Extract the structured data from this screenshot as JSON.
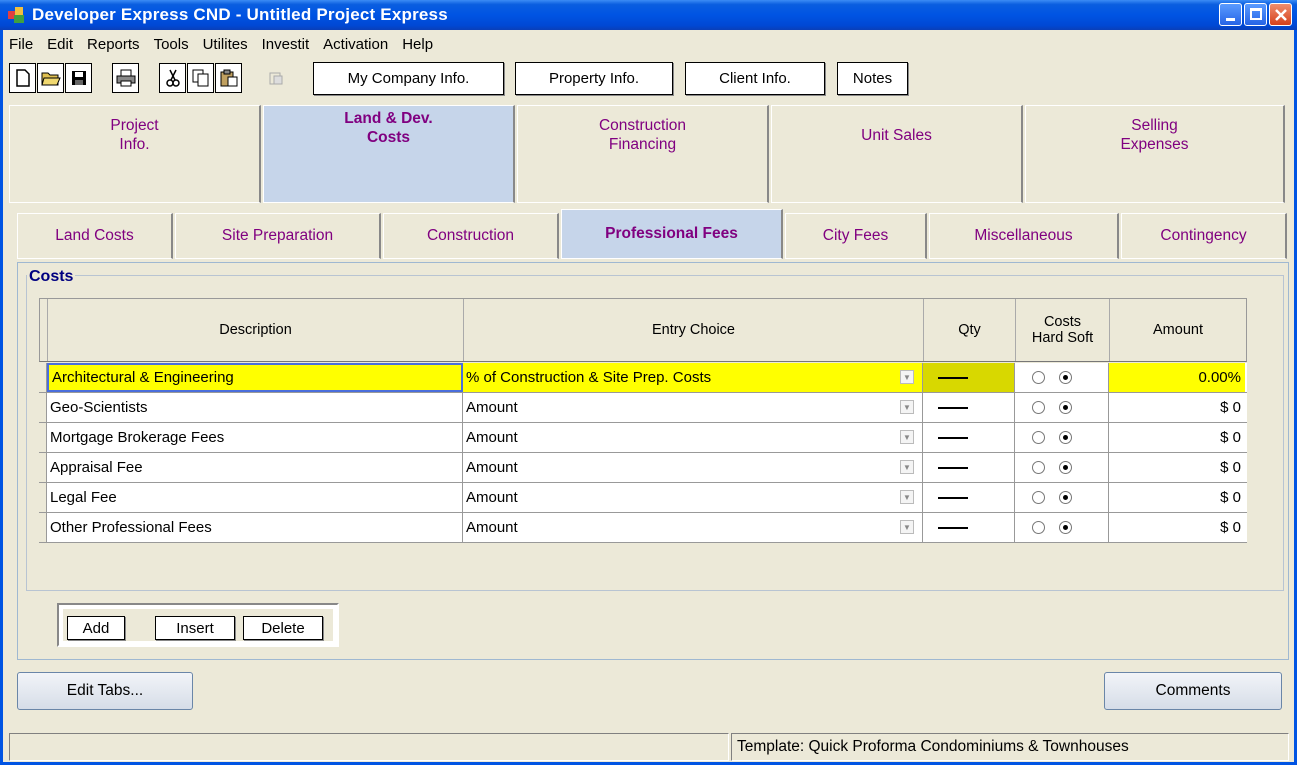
{
  "window": {
    "title": "Developer Express  CND - Untitled Project Express"
  },
  "menu": [
    {
      "label": "File"
    },
    {
      "label": "Edit"
    },
    {
      "label": "Reports"
    },
    {
      "label": "Tools"
    },
    {
      "label": "Utilites"
    },
    {
      "label": "Investit"
    },
    {
      "label": "Activation"
    },
    {
      "label": "Help"
    }
  ],
  "toolbar": {
    "company_label": "My Company Info.",
    "property_label": "Property Info.",
    "client_label": "Client Info.",
    "notes_label": "Notes"
  },
  "main_tabs": [
    {
      "line1": "Project",
      "line2": "Info."
    },
    {
      "line1": "Land & Dev.",
      "line2": "Costs"
    },
    {
      "line1": "Construction",
      "line2": "Financing"
    },
    {
      "line1": "Unit Sales",
      "line2": ""
    },
    {
      "line1": "Selling",
      "line2": "Expenses"
    }
  ],
  "sub_tabs": [
    {
      "label": "Land Costs"
    },
    {
      "label": "Site Preparation"
    },
    {
      "label": "Construction"
    },
    {
      "label": "Professional Fees"
    },
    {
      "label": "City Fees"
    },
    {
      "label": "Miscellaneous"
    },
    {
      "label": "Contingency"
    }
  ],
  "costs": {
    "legend": "Costs",
    "headers": {
      "description": "Description",
      "entry": "Entry Choice",
      "qty": "Qty",
      "costs_top": "Costs",
      "costs_bottom": "Hard Soft",
      "amount": "Amount"
    },
    "rows": [
      {
        "description": "Architectural & Engineering",
        "entry": "% of Construction & Site Prep. Costs",
        "amount": "0.00%"
      },
      {
        "description": "Geo-Scientists",
        "entry": "Amount",
        "amount": "$ 0"
      },
      {
        "description": "Mortgage Brokerage Fees",
        "entry": "Amount",
        "amount": "$ 0"
      },
      {
        "description": "Appraisal Fee",
        "entry": "Amount",
        "amount": "$ 0"
      },
      {
        "description": "Legal Fee",
        "entry": "Amount",
        "amount": "$ 0"
      },
      {
        "description": "Other Professional  Fees",
        "entry": "Amount",
        "amount": "$ 0"
      }
    ]
  },
  "buttons": {
    "add": "Add",
    "insert": "Insert",
    "delete": "Delete",
    "edit_tabs": "Edit Tabs...",
    "comments": "Comments"
  },
  "status": {
    "template": "Template: Quick Proforma Condominiums & Townhouses"
  }
}
